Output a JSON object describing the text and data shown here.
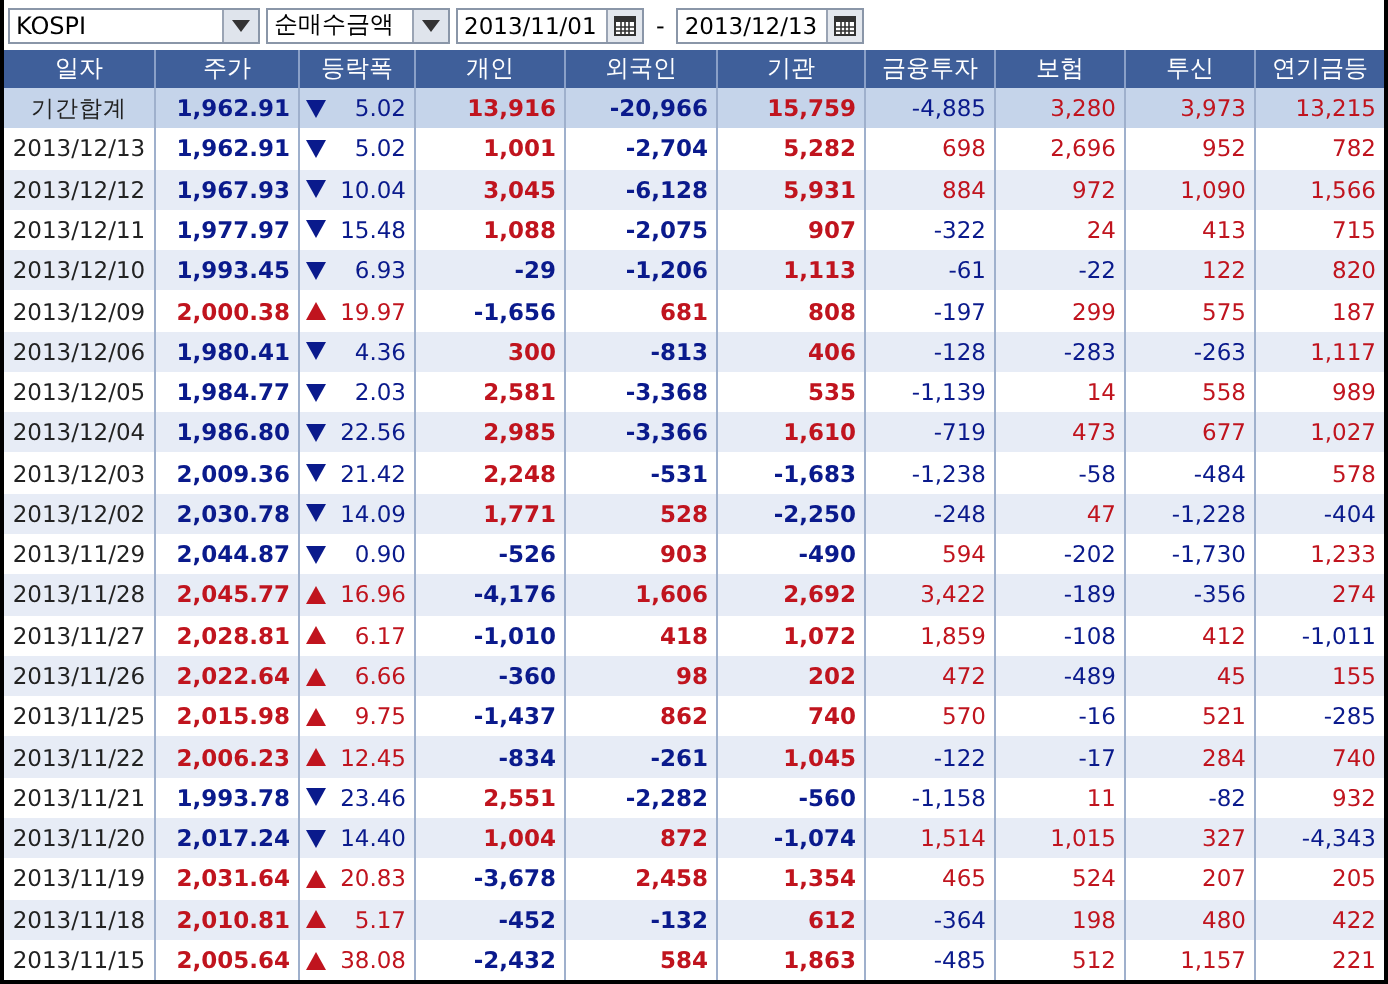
{
  "toolbar": {
    "market": "KOSPI",
    "metric": "순매수금액",
    "date_from": "2013/11/01",
    "separator": "-",
    "date_to": "2013/12/13"
  },
  "table": {
    "columns": [
      "일자",
      "주가",
      "등락폭",
      "개인",
      "외국인",
      "기관",
      "금융투자",
      "보험",
      "투신",
      "연기금등"
    ],
    "rows": [
      {
        "kind": "total",
        "date": "기간합계",
        "price": "1,962.91",
        "rising": false,
        "change": "5.02",
        "values": [
          "13,916",
          "-20,966",
          "15,759",
          "-4,885",
          "3,280",
          "3,973",
          "13,215"
        ]
      },
      {
        "kind": "day",
        "date": "2013/12/13",
        "price": "1,962.91",
        "rising": false,
        "change": "5.02",
        "values": [
          "1,001",
          "-2,704",
          "5,282",
          "698",
          "2,696",
          "952",
          "782"
        ]
      },
      {
        "kind": "day",
        "date": "2013/12/12",
        "price": "1,967.93",
        "rising": false,
        "change": "10.04",
        "values": [
          "3,045",
          "-6,128",
          "5,931",
          "884",
          "972",
          "1,090",
          "1,566"
        ]
      },
      {
        "kind": "day",
        "date": "2013/12/11",
        "price": "1,977.97",
        "rising": false,
        "change": "15.48",
        "values": [
          "1,088",
          "-2,075",
          "907",
          "-322",
          "24",
          "413",
          "715"
        ]
      },
      {
        "kind": "day",
        "date": "2013/12/10",
        "price": "1,993.45",
        "rising": false,
        "change": "6.93",
        "values": [
          "-29",
          "-1,206",
          "1,113",
          "-61",
          "-22",
          "122",
          "820"
        ]
      },
      {
        "kind": "day",
        "date": "2013/12/09",
        "price": "2,000.38",
        "rising": true,
        "change": "19.97",
        "values": [
          "-1,656",
          "681",
          "808",
          "-197",
          "299",
          "575",
          "187"
        ]
      },
      {
        "kind": "day",
        "date": "2013/12/06",
        "price": "1,980.41",
        "rising": false,
        "change": "4.36",
        "values": [
          "300",
          "-813",
          "406",
          "-128",
          "-283",
          "-263",
          "1,117"
        ]
      },
      {
        "kind": "day",
        "date": "2013/12/05",
        "price": "1,984.77",
        "rising": false,
        "change": "2.03",
        "values": [
          "2,581",
          "-3,368",
          "535",
          "-1,139",
          "14",
          "558",
          "989"
        ]
      },
      {
        "kind": "day",
        "date": "2013/12/04",
        "price": "1,986.80",
        "rising": false,
        "change": "22.56",
        "values": [
          "2,985",
          "-3,366",
          "1,610",
          "-719",
          "473",
          "677",
          "1,027"
        ]
      },
      {
        "kind": "day",
        "date": "2013/12/03",
        "price": "2,009.36",
        "rising": false,
        "change": "21.42",
        "values": [
          "2,248",
          "-531",
          "-1,683",
          "-1,238",
          "-58",
          "-484",
          "578"
        ]
      },
      {
        "kind": "day",
        "date": "2013/12/02",
        "price": "2,030.78",
        "rising": false,
        "change": "14.09",
        "values": [
          "1,771",
          "528",
          "-2,250",
          "-248",
          "47",
          "-1,228",
          "-404"
        ]
      },
      {
        "kind": "day",
        "date": "2013/11/29",
        "price": "2,044.87",
        "rising": false,
        "change": "0.90",
        "values": [
          "-526",
          "903",
          "-490",
          "594",
          "-202",
          "-1,730",
          "1,233"
        ]
      },
      {
        "kind": "day",
        "date": "2013/11/28",
        "price": "2,045.77",
        "rising": true,
        "change": "16.96",
        "values": [
          "-4,176",
          "1,606",
          "2,692",
          "3,422",
          "-189",
          "-356",
          "274"
        ]
      },
      {
        "kind": "day",
        "date": "2013/11/27",
        "price": "2,028.81",
        "rising": true,
        "change": "6.17",
        "values": [
          "-1,010",
          "418",
          "1,072",
          "1,859",
          "-108",
          "412",
          "-1,011"
        ]
      },
      {
        "kind": "day",
        "date": "2013/11/26",
        "price": "2,022.64",
        "rising": true,
        "change": "6.66",
        "values": [
          "-360",
          "98",
          "202",
          "472",
          "-489",
          "45",
          "155"
        ]
      },
      {
        "kind": "day",
        "date": "2013/11/25",
        "price": "2,015.98",
        "rising": true,
        "change": "9.75",
        "values": [
          "-1,437",
          "862",
          "740",
          "570",
          "-16",
          "521",
          "-285"
        ]
      },
      {
        "kind": "day",
        "date": "2013/11/22",
        "price": "2,006.23",
        "rising": true,
        "change": "12.45",
        "values": [
          "-834",
          "-261",
          "1,045",
          "-122",
          "-17",
          "284",
          "740"
        ]
      },
      {
        "kind": "day",
        "date": "2013/11/21",
        "price": "1,993.78",
        "rising": false,
        "change": "23.46",
        "values": [
          "2,551",
          "-2,282",
          "-560",
          "-1,158",
          "11",
          "-82",
          "932"
        ]
      },
      {
        "kind": "day",
        "date": "2013/11/20",
        "price": "2,017.24",
        "rising": false,
        "change": "14.40",
        "values": [
          "1,004",
          "872",
          "-1,074",
          "1,514",
          "1,015",
          "327",
          "-4,343"
        ]
      },
      {
        "kind": "day",
        "date": "2013/11/19",
        "price": "2,031.64",
        "rising": true,
        "change": "20.83",
        "values": [
          "-3,678",
          "2,458",
          "1,354",
          "465",
          "524",
          "207",
          "205"
        ]
      },
      {
        "kind": "day",
        "date": "2013/11/18",
        "price": "2,010.81",
        "rising": true,
        "change": "5.17",
        "values": [
          "-452",
          "-132",
          "612",
          "-364",
          "198",
          "480",
          "422"
        ]
      },
      {
        "kind": "day",
        "date": "2013/11/15",
        "price": "2,005.64",
        "rising": true,
        "change": "38.08",
        "values": [
          "-2,432",
          "584",
          "1,863",
          "-485",
          "512",
          "1,157",
          "221"
        ]
      }
    ]
  }
}
